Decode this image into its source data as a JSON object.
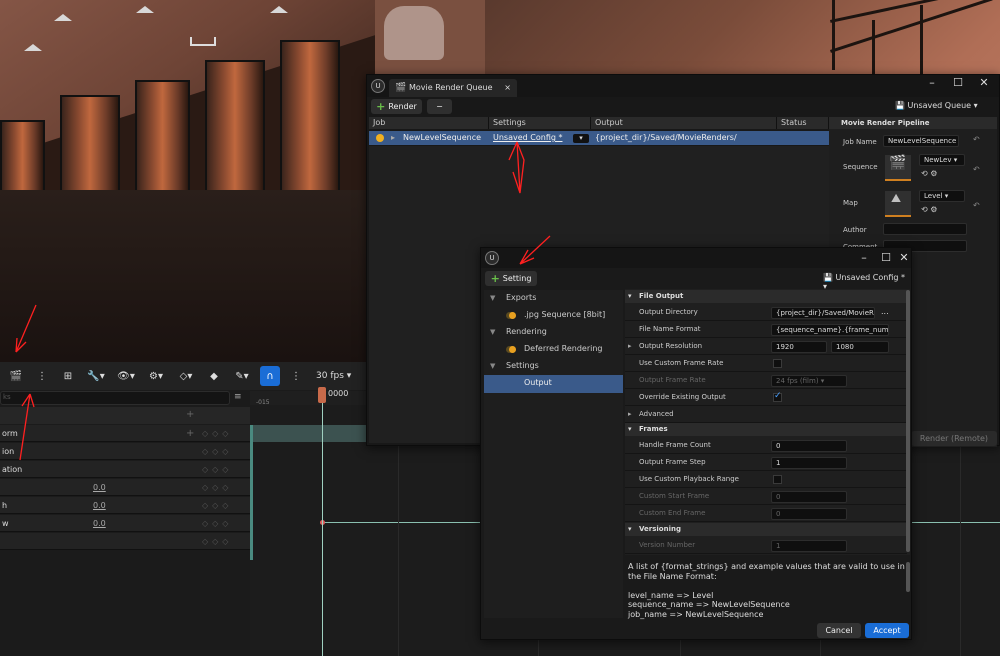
{
  "colors": {
    "accent_blue": "#1a6dd6",
    "job_row": "#3a5a8a",
    "status_yellow": "#f0b020",
    "plus_green": "#6ac04a",
    "annotation_red": "#ff2020"
  },
  "sequencer": {
    "fps": "30 fps",
    "search_placeholder": "ks",
    "frame_start": "-015",
    "frame_current": "0000",
    "rows": [
      {
        "label": "orm",
        "value": "",
        "has_add": true
      },
      {
        "label": "ion",
        "value": ""
      },
      {
        "label": "ation",
        "value": ""
      },
      {
        "label": "",
        "value": "0.0"
      },
      {
        "label": "h",
        "value": "0.0"
      },
      {
        "label": "w",
        "value": "0.0"
      },
      {
        "label": "",
        "value": ""
      }
    ]
  },
  "mrq": {
    "tab_title": "Movie Render Queue",
    "render_label": "Render",
    "remove_label": "−",
    "queue_name": "Unsaved Queue",
    "columns": {
      "job": "Job",
      "settings": "Settings",
      "output": "Output",
      "status": "Status"
    },
    "job": {
      "name": "NewLevelSequence",
      "settings": "Unsaved Config *",
      "output": "{project_dir}/Saved/MovieRenders/"
    },
    "pipeline": {
      "header": "Movie Render Pipeline",
      "job_name_label": "Job Name",
      "job_name_value": "NewLevelSequence",
      "sequence_label": "Sequence",
      "sequence_value": "NewLev",
      "map_label": "Map",
      "map_value": "Level",
      "author_label": "Author",
      "comment_label": "Comment"
    },
    "render_remote": "Render (Remote)"
  },
  "setting": {
    "add_label": "Setting",
    "config_name": "Unsaved Config *",
    "tree": [
      {
        "type": "group",
        "label": "Exports"
      },
      {
        "type": "item",
        "label": ".jpg Sequence [8bit]"
      },
      {
        "type": "group",
        "label": "Rendering"
      },
      {
        "type": "item",
        "label": "Deferred Rendering"
      },
      {
        "type": "group",
        "label": "Settings"
      },
      {
        "type": "selected",
        "label": "Output"
      }
    ],
    "file_output": {
      "section": "File Output",
      "output_directory_label": "Output Directory",
      "output_directory_value": "{project_dir}/Saved/MovieRenc",
      "browse": "...",
      "file_name_format_label": "File Name Format",
      "file_name_format_value": "{sequence_name}.{frame_number}",
      "output_resolution_label": "Output Resolution",
      "res_x": "1920",
      "res_y": "1080",
      "use_custom_frame_rate_label": "Use Custom Frame Rate",
      "output_frame_rate_label": "Output Frame Rate",
      "output_frame_rate_value": "24 fps (film)",
      "override_existing_label": "Override Existing Output",
      "advanced_label": "Advanced"
    },
    "frames": {
      "section": "Frames",
      "handle_frame_count_label": "Handle Frame Count",
      "handle_frame_count_value": "0",
      "output_frame_step_label": "Output Frame Step",
      "output_frame_step_value": "1",
      "use_custom_playback_label": "Use Custom Playback Range",
      "custom_start_label": "Custom Start Frame",
      "custom_start_value": "0",
      "custom_end_label": "Custom End Frame",
      "custom_end_value": "0"
    },
    "versioning": {
      "section": "Versioning",
      "version_number_label": "Version Number",
      "version_number_value": "1"
    },
    "description": "A list of {format_strings} and example values that are valid to use in the File Name Format:\n\nlevel_name => Level\nsequence_name => NewLevelSequence\njob_name => NewLevelSequence",
    "cancel_label": "Cancel",
    "accept_label": "Accept"
  }
}
